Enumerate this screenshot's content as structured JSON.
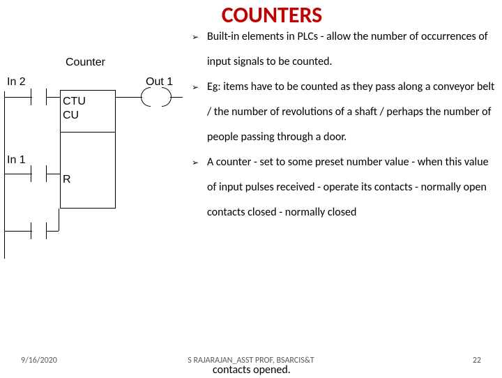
{
  "title": "COUNTERS",
  "bullets": [
    "Built-in elements in PLCs - allow the number of occurrences of input signals to be counted.",
    "Eg: items have to be counted as they pass along a conveyor belt / the number of revolutions of a shaft / perhaps the number of people passing through a door.",
    "A counter - set to some preset number value - when this value of input pulses received - operate its contacts - normally open contacts closed -  normally closed"
  ],
  "trailing_line": "contacts opened.",
  "diagram": {
    "title": "Counter",
    "in2": "In 2",
    "out1": "Out 1",
    "ctu": "CTU",
    "cu": "CU",
    "in1": "In 1",
    "r": "R"
  },
  "footer": {
    "date": "9/16/2020",
    "center": "S RAJARAJAN_ASST PROF, BSARCIS&T",
    "page": "22"
  },
  "arrow_glyph": "➢"
}
